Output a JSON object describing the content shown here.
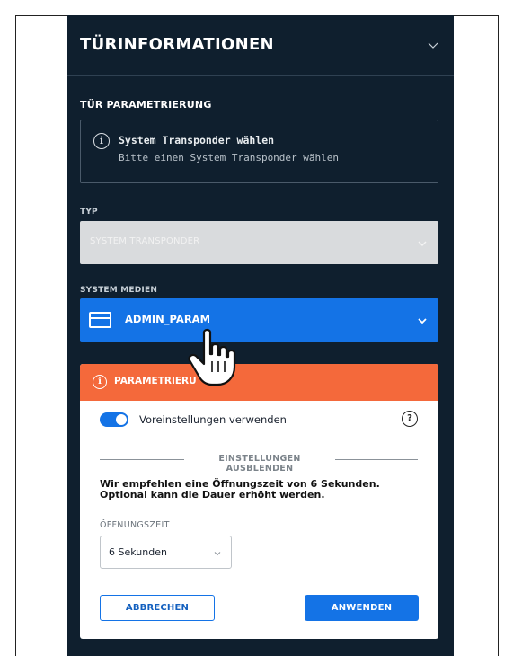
{
  "panel": {
    "title": "TÜRINFORMATIONEN",
    "section_heading": "TÜR PARAMETRIERUNG"
  },
  "info": {
    "icon": "info-icon",
    "title": "System Transponder wählen",
    "subtitle": "Bitte einen System Transponder wählen"
  },
  "typ": {
    "label": "TYP",
    "value": "SYSTEM TRANSPONDER"
  },
  "system_medien": {
    "label": "SYSTEM MEDIEN",
    "value": "ADMIN_PARAM",
    "icon": "card-icon"
  },
  "param_card": {
    "header_label": "PARAMETRIERU",
    "toggle_label": "Voreinstellungen verwenden",
    "toggle_on": true,
    "help_icon": "?",
    "separator_label": "EINSTELLUNGEN AUSBLENDEN",
    "recommendation": "Wir empfehlen eine Öffnungszeit von 6 Sekunden. Optional kann die Dauer erhöht werden.",
    "oeffnungszeit_label": "ÖFFNUNGSZEIT",
    "oeffnungszeit_value": "6 Sekunden",
    "cancel_label": "ABBRECHEN",
    "apply_label": "ANWENDEN"
  },
  "colors": {
    "panel_bg": "#0f1f2e",
    "accent_blue": "#1473e6",
    "warning_orange": "#f4693b"
  }
}
